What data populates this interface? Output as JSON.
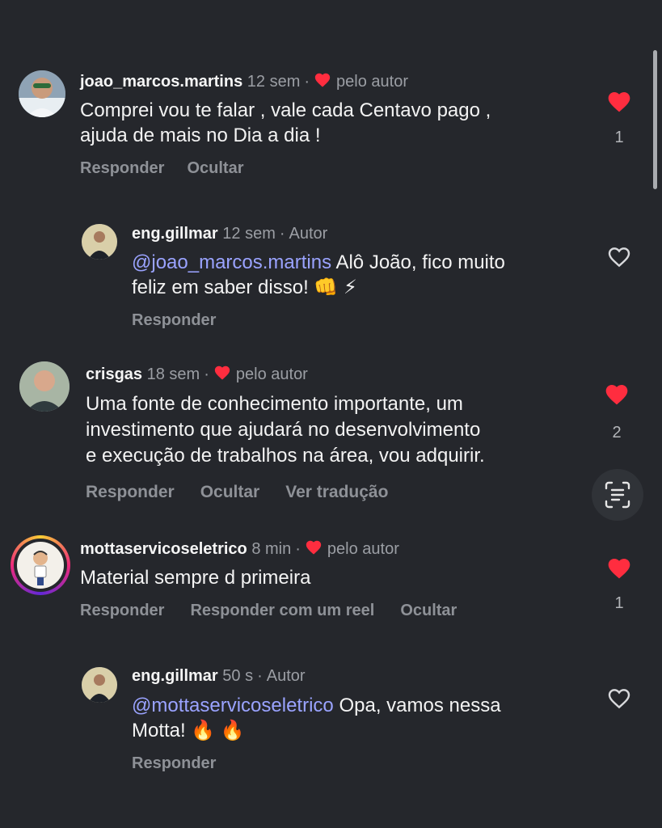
{
  "colors": {
    "background": "#25272c",
    "mention": "#9aa3ff",
    "heart": "#ff2d3f",
    "muted": "#9b9ea4"
  },
  "comments": [
    {
      "username": "joao_marcos.martins",
      "time": "12 sem",
      "badge_label": "pelo autor",
      "badge_icon": "heart-icon",
      "lines": [
        "Comprei vou te falar , vale cada Centavo pago ,",
        "ajuda de mais no Dia a dia !"
      ],
      "actions": {
        "reply": "Responder",
        "hide": "Ocultar"
      },
      "likes": "1",
      "liked": true
    },
    {
      "username": "eng.gillmar",
      "time": "12 sem",
      "author_label": "Autor",
      "mention": "@joao_marcos.martins",
      "line1": " Alô João, fico muito",
      "line2": "feliz em saber disso! 👊 ⚡",
      "actions": {
        "reply": "Responder"
      },
      "liked": false
    },
    {
      "username": "crisgas",
      "time": "18 sem",
      "badge_label": "pelo autor",
      "lines": [
        "Uma fonte de conhecimento importante, um",
        "investimento que ajudará no desenvolvimento",
        "e execução de trabalhos na área, vou adquirir."
      ],
      "actions": {
        "reply": "Responder",
        "hide": "Ocultar",
        "translate": "Ver tradução"
      },
      "likes": "2",
      "liked": true
    },
    {
      "username": "mottaservicoseletrico",
      "time": "8 min",
      "badge_label": "pelo autor",
      "lines": [
        "Material sempre d primeira"
      ],
      "actions": {
        "reply": "Responder",
        "reel": "Responder com um reel",
        "hide": "Ocultar"
      },
      "likes": "1",
      "liked": true
    },
    {
      "username": "eng.gillmar",
      "time": "50 s",
      "author_label": "Autor",
      "mention": "@mottaservicoseletrico",
      "line1": " Opa, vamos nessa",
      "line2": "Motta! 🔥 🔥",
      "actions": {
        "reply": "Responder"
      },
      "liked": false
    }
  ]
}
